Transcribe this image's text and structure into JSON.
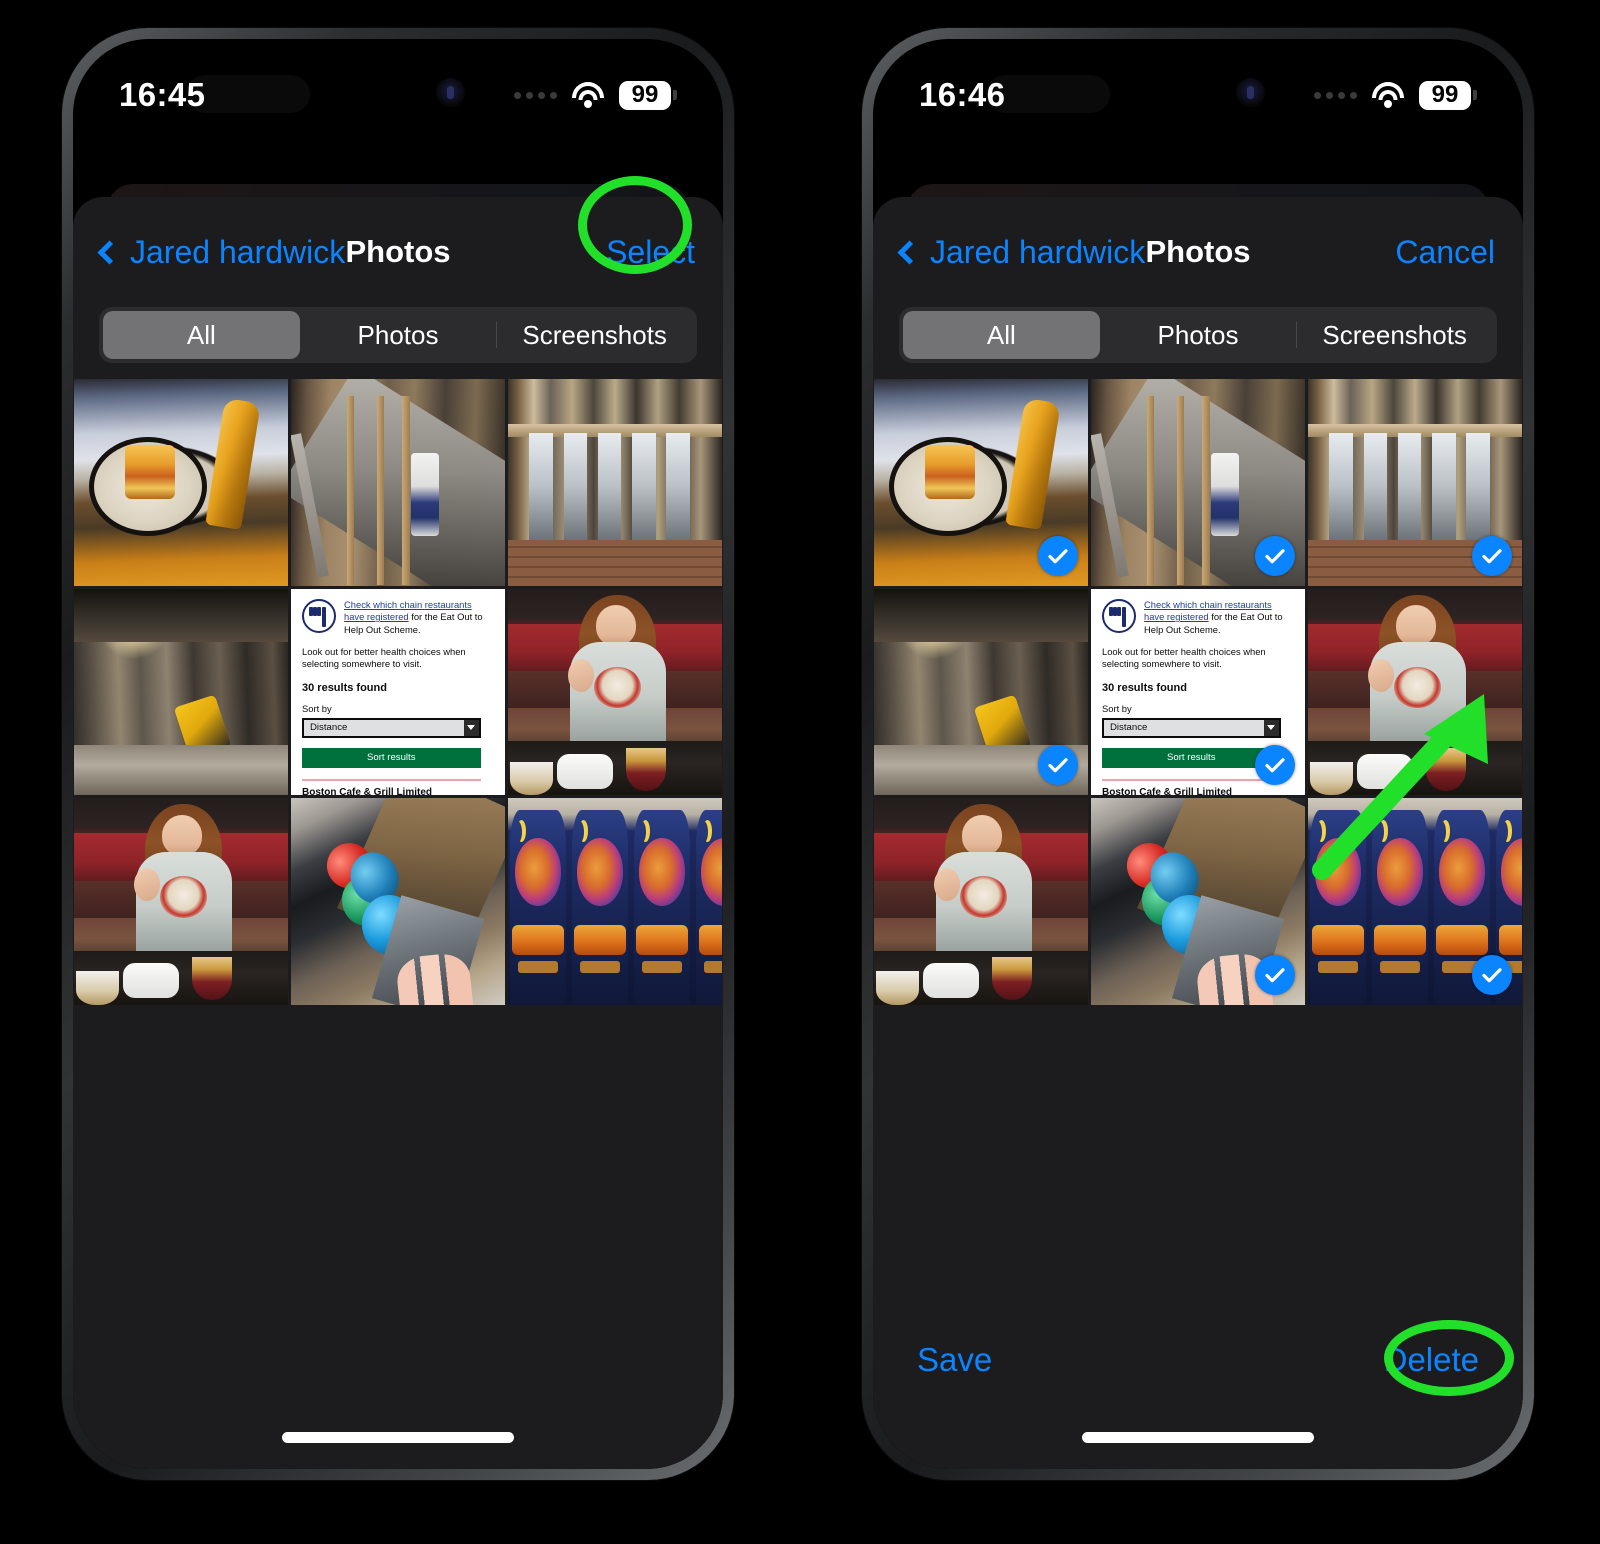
{
  "annotation": {
    "highlight_color": "#22e02a"
  },
  "accent_color": "#0a84ff",
  "phones": [
    {
      "id": "left",
      "status": {
        "time": "16:45",
        "battery": "99",
        "wifi_icon": "wifi-icon",
        "dots_icon": "signal-dots-icon"
      },
      "nav": {
        "back_label": "Jared hardwick",
        "back_icon": "chevron-left-icon",
        "title": "Photos",
        "action_label": "Select"
      },
      "segments": [
        {
          "label": "All",
          "active": true
        },
        {
          "label": "Photos",
          "active": false
        },
        {
          "label": "Screenshots",
          "active": false
        }
      ],
      "selection_mode": false,
      "toolbar": {
        "visible": false,
        "save_label": "Save",
        "delete_label": "Delete"
      }
    },
    {
      "id": "right",
      "status": {
        "time": "16:46",
        "battery": "99",
        "wifi_icon": "wifi-icon",
        "dots_icon": "signal-dots-icon"
      },
      "nav": {
        "back_label": "Jared hardwick",
        "back_icon": "chevron-left-icon",
        "title": "Photos",
        "action_label": "Cancel"
      },
      "segments": [
        {
          "label": "All",
          "active": true
        },
        {
          "label": "Photos",
          "active": false
        },
        {
          "label": "Screenshots",
          "active": false
        }
      ],
      "selection_mode": true,
      "toolbar": {
        "visible": true,
        "save_label": "Save",
        "delete_label": "Delete"
      }
    }
  ],
  "photo_grid": {
    "columns": 3,
    "items": [
      {
        "name": "thumb-plate-of-food-with-beer",
        "kind": "photo",
        "selected": true
      },
      {
        "name": "thumb-loft-timber-framing",
        "kind": "photo",
        "selected": true
      },
      {
        "name": "thumb-stud-wall-window",
        "kind": "photo",
        "selected": true
      },
      {
        "name": "thumb-stripped-room-with-saw",
        "kind": "photo",
        "selected": true
      },
      {
        "name": "thumb-eat-out-to-help-out",
        "kind": "screenshot",
        "selected": true
      },
      {
        "name": "thumb-woman-in-booth-a",
        "kind": "photo",
        "selected": true
      },
      {
        "name": "thumb-woman-in-booth-b",
        "kind": "photo",
        "selected": true
      },
      {
        "name": "thumb-foil-eggs-in-box",
        "kind": "photo",
        "selected": true
      },
      {
        "name": "thumb-roar-drink-bottles",
        "kind": "photo",
        "selected": true
      }
    ]
  },
  "screenshot_thumb": {
    "link_text": "Check which chain restaurants have registered",
    "lead_rest": " for the Eat Out to Help Out Scheme.",
    "body": "Look out for better health choices when selecting somewhere to visit.",
    "results_count": "30 results found",
    "sort_label": "Sort by",
    "sort_value": "Distance",
    "sort_button": "Sort results",
    "next_heading": "Boston Cafe & Grill Limited",
    "restaurant_icon": "knife-and-fork-icon"
  }
}
